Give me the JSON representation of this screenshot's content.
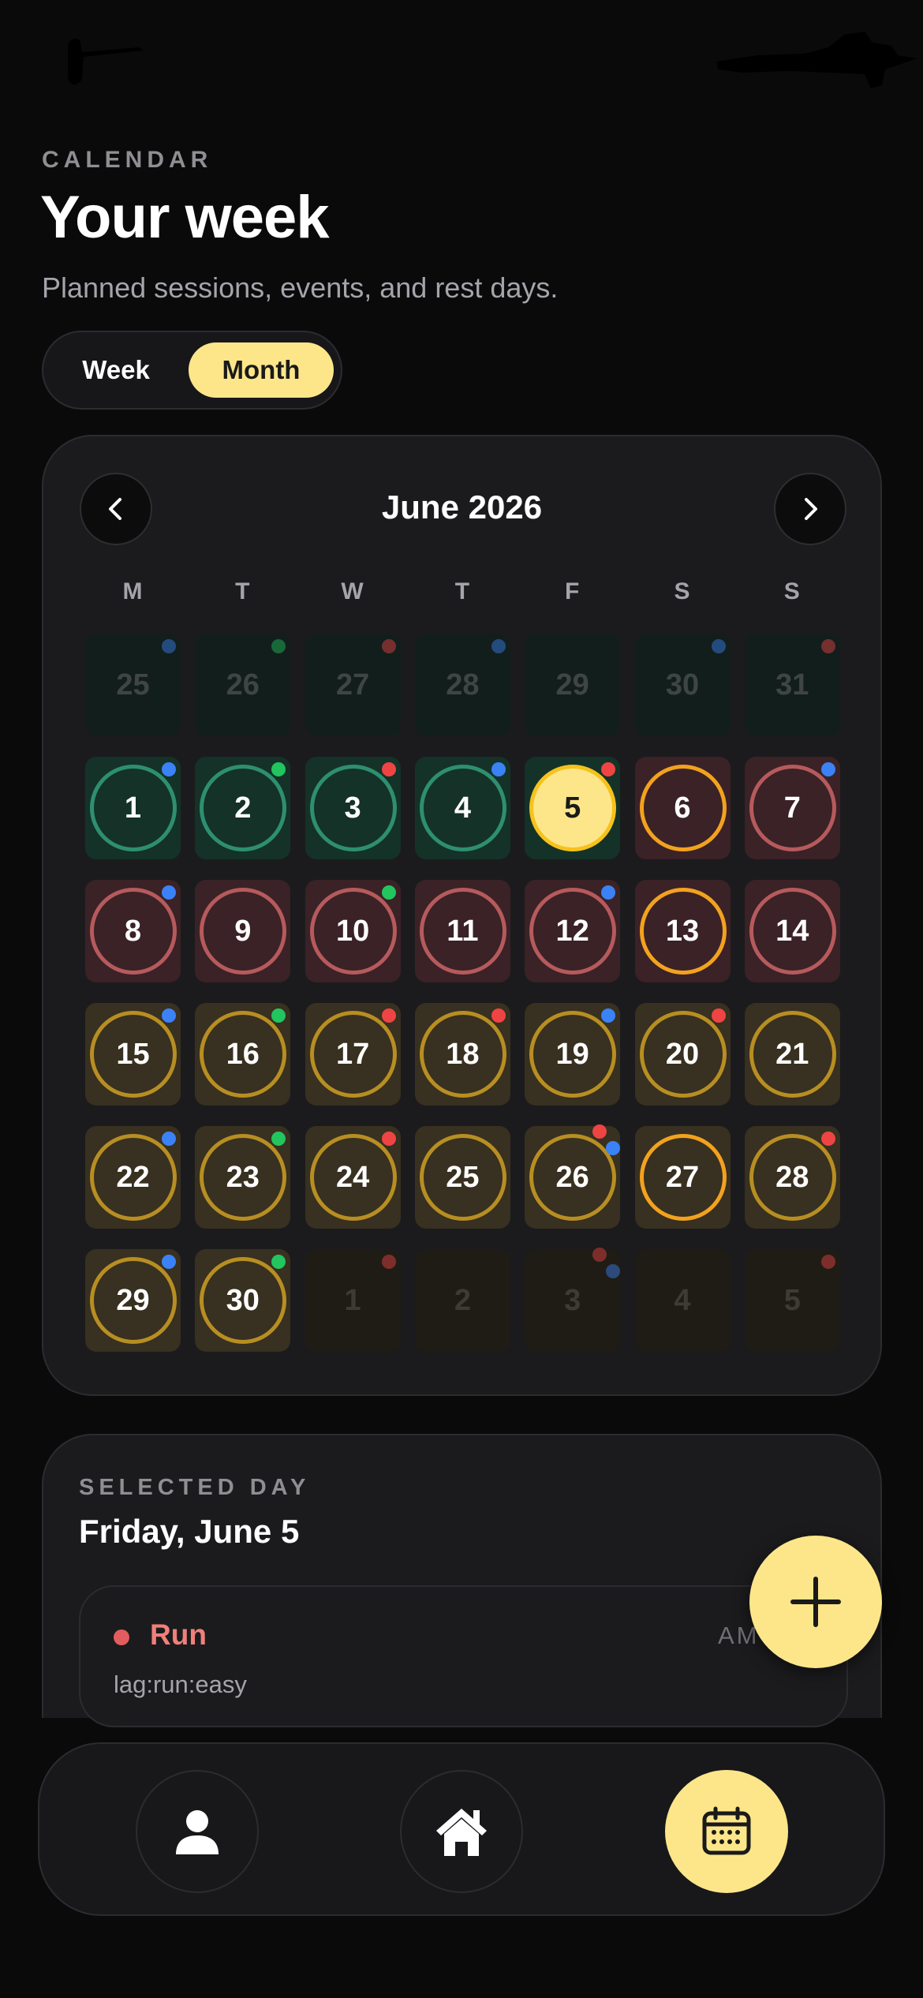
{
  "header": {
    "eyebrow": "CALENDAR",
    "title": "Your week",
    "subtitle": "Planned sessions, events, and rest days."
  },
  "view_toggle": {
    "options": [
      "Week",
      "Month"
    ],
    "selected": "Month"
  },
  "calendar": {
    "month_label": "June 2026",
    "weekdays": [
      "M",
      "T",
      "W",
      "T",
      "F",
      "S",
      "S"
    ],
    "selected_day": "5",
    "colors": {
      "green": "#2e8f6f",
      "red": "#b65a5c",
      "gold": "#b78e22",
      "orange": "#f3a21e",
      "today": "#fde68a",
      "dot_blue": "#3b82f6",
      "dot_green": "#22c55e",
      "dot_red": "#ef4444"
    },
    "weeks": [
      [
        {
          "n": "25",
          "month": "prev",
          "tone": "green",
          "dots": [
            "blue"
          ]
        },
        {
          "n": "26",
          "month": "prev",
          "tone": "green",
          "dots": [
            "green"
          ]
        },
        {
          "n": "27",
          "month": "prev",
          "tone": "green",
          "dots": [
            "red"
          ]
        },
        {
          "n": "28",
          "month": "prev",
          "tone": "green",
          "dots": [
            "blue"
          ]
        },
        {
          "n": "29",
          "month": "prev",
          "tone": "green",
          "dots": []
        },
        {
          "n": "30",
          "month": "prev",
          "tone": "green",
          "dots": [
            "blue"
          ]
        },
        {
          "n": "31",
          "month": "prev",
          "tone": "green",
          "dots": [
            "red"
          ]
        }
      ],
      [
        {
          "n": "1",
          "month": "current",
          "tone": "green",
          "ring": "green",
          "dots": [
            "blue"
          ]
        },
        {
          "n": "2",
          "month": "current",
          "tone": "green",
          "ring": "green",
          "dots": [
            "green"
          ]
        },
        {
          "n": "3",
          "month": "current",
          "tone": "green",
          "ring": "green",
          "dots": [
            "red"
          ]
        },
        {
          "n": "4",
          "month": "current",
          "tone": "green",
          "ring": "green",
          "dots": [
            "blue"
          ]
        },
        {
          "n": "5",
          "month": "current",
          "tone": "green",
          "ring": "today",
          "dots": [
            "red"
          ]
        },
        {
          "n": "6",
          "month": "current",
          "tone": "red",
          "ring": "orange",
          "dots": []
        },
        {
          "n": "7",
          "month": "current",
          "tone": "red",
          "ring": "red",
          "dots": [
            "blue"
          ]
        }
      ],
      [
        {
          "n": "8",
          "month": "current",
          "tone": "red",
          "ring": "red",
          "dots": [
            "blue"
          ]
        },
        {
          "n": "9",
          "month": "current",
          "tone": "red",
          "ring": "red",
          "dots": []
        },
        {
          "n": "10",
          "month": "current",
          "tone": "red",
          "ring": "red",
          "dots": [
            "green"
          ]
        },
        {
          "n": "11",
          "month": "current",
          "tone": "red",
          "ring": "red",
          "dots": []
        },
        {
          "n": "12",
          "month": "current",
          "tone": "red",
          "ring": "red",
          "dots": [
            "blue"
          ]
        },
        {
          "n": "13",
          "month": "current",
          "tone": "red",
          "ring": "orange",
          "dots": []
        },
        {
          "n": "14",
          "month": "current",
          "tone": "red",
          "ring": "red",
          "dots": []
        }
      ],
      [
        {
          "n": "15",
          "month": "current",
          "tone": "gold",
          "ring": "gold",
          "dots": [
            "blue"
          ]
        },
        {
          "n": "16",
          "month": "current",
          "tone": "gold",
          "ring": "gold",
          "dots": [
            "green"
          ]
        },
        {
          "n": "17",
          "month": "current",
          "tone": "gold",
          "ring": "gold",
          "dots": [
            "red"
          ]
        },
        {
          "n": "18",
          "month": "current",
          "tone": "gold",
          "ring": "gold",
          "dots": [
            "red"
          ]
        },
        {
          "n": "19",
          "month": "current",
          "tone": "gold",
          "ring": "gold",
          "dots": [
            "blue"
          ]
        },
        {
          "n": "20",
          "month": "current",
          "tone": "gold",
          "ring": "gold",
          "dots": [
            "red"
          ]
        },
        {
          "n": "21",
          "month": "current",
          "tone": "gold",
          "ring": "gold",
          "dots": []
        }
      ],
      [
        {
          "n": "22",
          "month": "current",
          "tone": "gold",
          "ring": "gold",
          "dots": [
            "blue"
          ]
        },
        {
          "n": "23",
          "month": "current",
          "tone": "gold",
          "ring": "gold",
          "dots": [
            "green"
          ]
        },
        {
          "n": "24",
          "month": "current",
          "tone": "gold",
          "ring": "gold",
          "dots": [
            "red"
          ]
        },
        {
          "n": "25",
          "month": "current",
          "tone": "gold",
          "ring": "gold",
          "dots": []
        },
        {
          "n": "26",
          "month": "current",
          "tone": "gold",
          "ring": "gold",
          "dots": [
            "red",
            "blue"
          ]
        },
        {
          "n": "27",
          "month": "current",
          "tone": "gold",
          "ring": "orange",
          "dots": []
        },
        {
          "n": "28",
          "month": "current",
          "tone": "gold",
          "ring": "gold",
          "dots": [
            "red"
          ]
        }
      ],
      [
        {
          "n": "29",
          "month": "current",
          "tone": "gold",
          "ring": "gold",
          "dots": [
            "blue"
          ]
        },
        {
          "n": "30",
          "month": "current",
          "tone": "gold",
          "ring": "gold",
          "dots": [
            "green"
          ]
        },
        {
          "n": "1",
          "month": "next",
          "tone": "gold",
          "dots": [
            "red"
          ]
        },
        {
          "n": "2",
          "month": "next",
          "tone": "gold",
          "dots": []
        },
        {
          "n": "3",
          "month": "next",
          "tone": "gold",
          "dots": [
            "red",
            "blue"
          ]
        },
        {
          "n": "4",
          "month": "next",
          "tone": "gold",
          "dots": []
        },
        {
          "n": "5",
          "month": "next",
          "tone": "gold",
          "dots": [
            "red"
          ]
        }
      ]
    ]
  },
  "selected_day": {
    "eyebrow": "SELECTED DAY",
    "title": "Friday, June 5",
    "events": [
      {
        "name": "Run",
        "tag": "lag:run:easy",
        "time": "AM",
        "color": "#e25d5d"
      }
    ]
  },
  "fab": {
    "icon": "plus-icon"
  },
  "bottom_nav": {
    "items": [
      {
        "icon": "person-icon",
        "active": false
      },
      {
        "icon": "home-icon",
        "active": false
      },
      {
        "icon": "calendar-icon",
        "active": true
      }
    ]
  }
}
